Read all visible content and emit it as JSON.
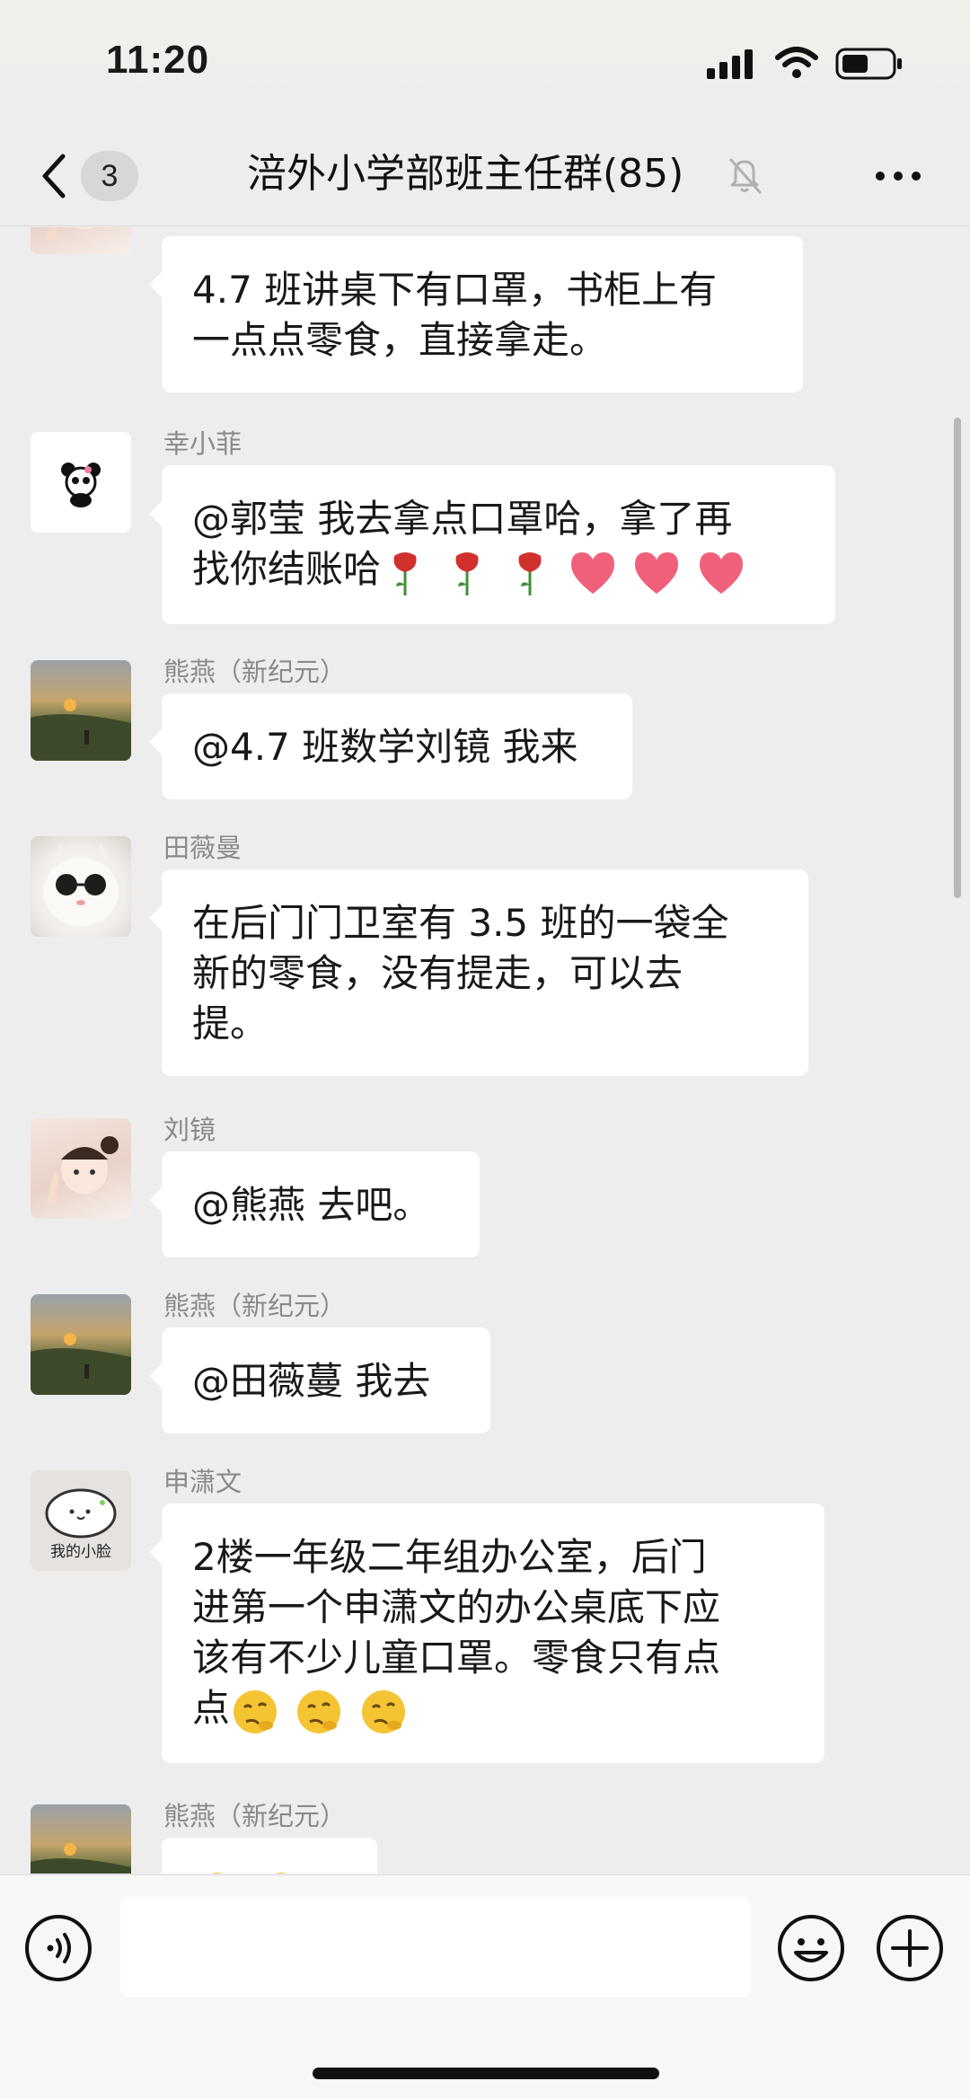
{
  "status": {
    "time": "11:20"
  },
  "header": {
    "back_label": "",
    "unread_count": "3",
    "title": "涪外小学部班主任群(85)"
  },
  "messages": [
    {
      "sender": "",
      "avatar": "girl-peace-sign-avatar",
      "text": [
        "4.7 班讲桌下有口罩，书柜上有",
        "一点点零食，直接拿走。"
      ]
    },
    {
      "sender": "幸小菲",
      "avatar": "panda-avatar",
      "text": [
        "@郭莹 我去拿点口罩哈，拿了再",
        "找你结账哈"
      ],
      "emoji": [
        "rose",
        "rose",
        "rose",
        "heart",
        "heart",
        "heart"
      ]
    },
    {
      "sender": "熊燕（新纪元）",
      "avatar": "sunset-hill-avatar",
      "text": [
        "@4.7 班数学刘镜 我来"
      ]
    },
    {
      "sender": "田薇曼",
      "avatar": "cat-sunglasses-avatar",
      "text": [
        "在后门门卫室有 3.5 班的一袋全",
        "新的零食，没有提走，可以去",
        "提。"
      ]
    },
    {
      "sender": "刘镜",
      "avatar": "girl-peace-sign-avatar",
      "text": [
        "@熊燕 去吧。"
      ]
    },
    {
      "sender": "熊燕（新纪元）",
      "avatar": "sunset-hill-avatar",
      "text": [
        "@田薇蔓 我去"
      ]
    },
    {
      "sender": "申潇文",
      "avatar": "bun-avatar",
      "avatar_caption": "我的小脸",
      "text": [
        "2楼一年级二年组办公室，后门",
        "进第一个申潇文的办公桌底下应",
        "该有不少儿童口罩。零食只有点",
        "点"
      ],
      "emoji": [
        "thinking",
        "thinking",
        "thinking"
      ]
    },
    {
      "sender": "熊燕（新纪元）",
      "avatar": "sunset-hill-avatar",
      "text": [
        ""
      ],
      "emoji": [
        "thinking",
        "thinking",
        "thinking"
      ]
    }
  ],
  "input": {
    "placeholder": ""
  },
  "icons": {
    "back": "chevron-left-icon",
    "mute": "bell-slash-icon",
    "more": "ellipsis-icon",
    "voice": "voice-icon",
    "emoji": "smile-icon",
    "plus": "plus-icon"
  },
  "colors": {
    "background": "#ededed",
    "bubble": "#ffffff",
    "rose": "#d0312d",
    "heart": "#f0607a",
    "thinking": "#f5c433"
  }
}
